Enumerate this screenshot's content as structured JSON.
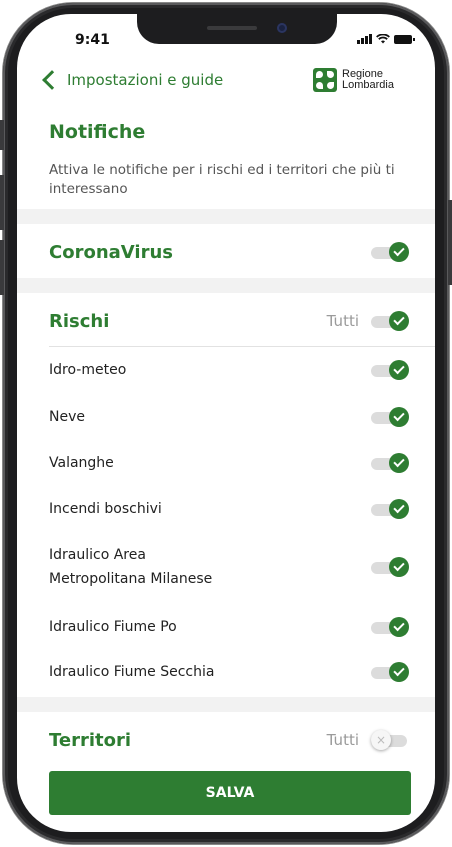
{
  "status_bar": {
    "time": "9:41"
  },
  "nav": {
    "back_label": "Impostazioni e guide",
    "logo_line1": "Regione",
    "logo_line2": "Lombardia"
  },
  "page": {
    "title": "Notifiche",
    "description": "Attiva le notifiche per i rischi ed i territori che più ti interessano"
  },
  "coronavirus": {
    "label": "CoronaVirus",
    "enabled": true
  },
  "rischi": {
    "label": "Rischi",
    "all_label": "Tutti",
    "all_enabled": true,
    "items": [
      {
        "label": "Idro-meteo",
        "enabled": true
      },
      {
        "label": "Neve",
        "enabled": true
      },
      {
        "label": "Valanghe",
        "enabled": true
      },
      {
        "label": "Incendi boschivi",
        "enabled": true
      },
      {
        "label": "Idraulico Area Metropolitana Milanese",
        "enabled": true
      },
      {
        "label": "Idraulico Fiume Po",
        "enabled": true
      },
      {
        "label": "Idraulico Fiume Secchia",
        "enabled": true
      }
    ]
  },
  "territori": {
    "label": "Territori",
    "all_label": "Tutti",
    "all_enabled": false
  },
  "footer": {
    "save_label": "SALVA"
  },
  "colors": {
    "accent": "#2e7d32",
    "text": "#222222",
    "muted": "#9a9a9a",
    "separator": "#f2f2f2"
  }
}
